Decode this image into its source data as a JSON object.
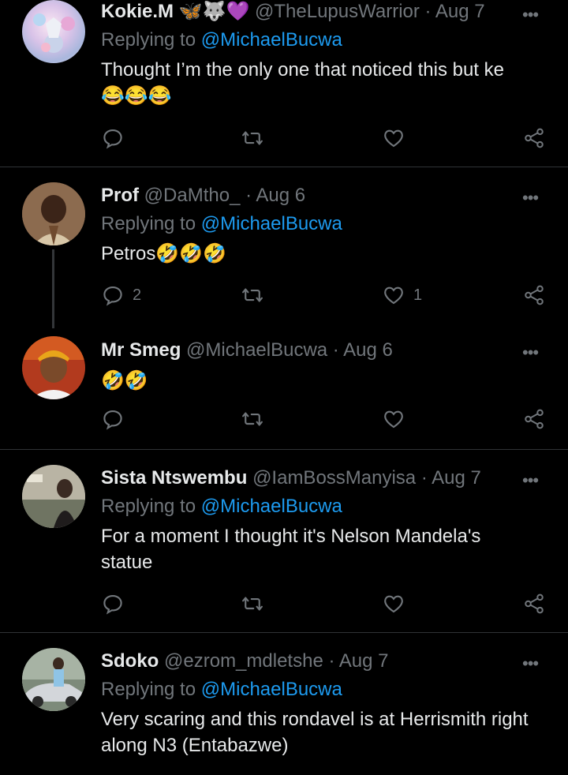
{
  "reply_label": "Replying to",
  "tweets": [
    {
      "name": "Kokie.M 🦋🐺💜",
      "handle": "@TheLupusWarrior · Aug 7",
      "reply_to": "@MichaelBucwa",
      "text": "Thought I’m the only one that noticed this but ke",
      "emoji_line": "😂😂😂",
      "reply_count": "",
      "like_count": ""
    },
    {
      "name": "Prof",
      "handle": "@DaMtho_ · Aug 6",
      "reply_to": "@MichaelBucwa",
      "text": "Petros🤣🤣🤣",
      "reply_count": "2",
      "like_count": "1"
    },
    {
      "name": "Mr Smeg",
      "handle": "@MichaelBucwa · Aug 6",
      "text": "🤣🤣",
      "reply_count": "",
      "like_count": ""
    },
    {
      "name": "Sista Ntswembu",
      "handle": "@IamBossManyisa · Aug 7",
      "reply_to": "@MichaelBucwa",
      "text": "For a moment I thought it's Nelson Mandela's statue",
      "reply_count": "",
      "like_count": ""
    },
    {
      "name": "Sdoko",
      "handle": "@ezrom_mdletshe · Aug 7",
      "reply_to": "@MichaelBucwa",
      "text": "Very scaring and this rondavel is at Herrismith right along N3 (Entabazwe)",
      "reply_count": "",
      "like_count": ""
    }
  ],
  "colors": {
    "link": "#1d9bf0",
    "muted": "#71767b",
    "text": "#e7e9ea",
    "background": "#000000"
  }
}
